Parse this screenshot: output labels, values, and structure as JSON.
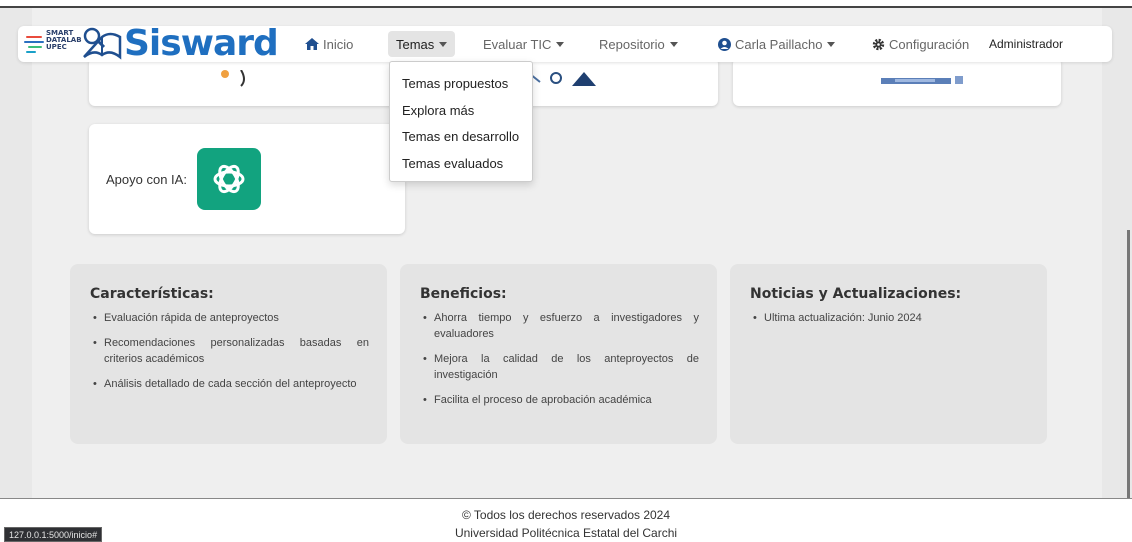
{
  "brand": {
    "lab_text": [
      "SMART",
      "DATALAB",
      "UPEC"
    ],
    "name": "Sisward",
    "color": "#1f6fc0"
  },
  "nav": {
    "inicio": "Inicio",
    "temas": "Temas",
    "evaluar": "Evaluar TIC",
    "repositorio": "Repositorio",
    "user": "Carla Paillacho",
    "config": "Configuración",
    "admin": "Administrador"
  },
  "dropdown": {
    "items": [
      "Temas propuestos",
      "Explora más",
      "Temas en desarrollo",
      "Temas evaluados"
    ]
  },
  "ia_card": {
    "label": "Apoyo con IA:",
    "logo_color": "#12a37f"
  },
  "features": {
    "title": "Características:",
    "items": [
      "Evaluación rápida de anteproyectos",
      "Recomendaciones personalizadas basadas en criterios académicos",
      "Análisis detallado de cada sección del anteproyecto"
    ]
  },
  "benefits": {
    "title": "Beneficios:",
    "items": [
      "Ahorra tiempo y esfuerzo a investigadores y evaluadores",
      "Mejora la calidad de los anteproyectos de investigación",
      "Facilita el proceso de aprobación académica"
    ]
  },
  "news": {
    "title": "Noticias y Actualizaciones:",
    "items": [
      "Ultima actualización: Junio 2024"
    ]
  },
  "footer": {
    "line1": "© Todos los derechos reservados 2024",
    "line2": "Universidad Politécnica Estatal del Carchi"
  },
  "status_url": "127.0.0.1:5000/inicio#"
}
